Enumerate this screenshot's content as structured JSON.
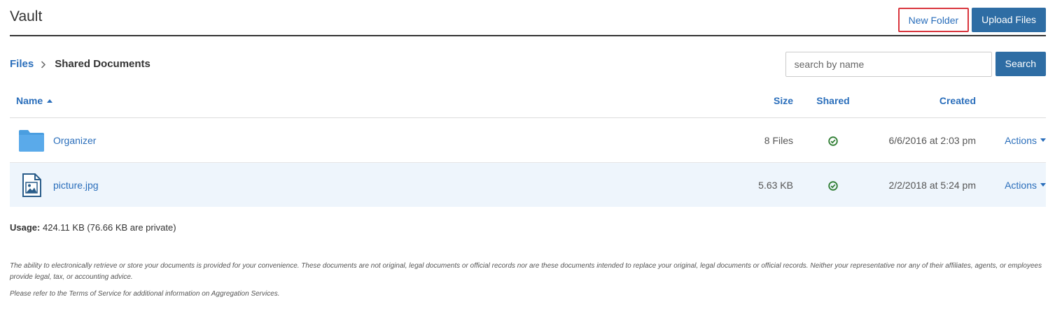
{
  "header": {
    "title": "Vault",
    "new_folder_label": "New Folder",
    "upload_files_label": "Upload Files"
  },
  "breadcrumb": {
    "root": "Files",
    "current": "Shared Documents"
  },
  "search": {
    "placeholder": "search by name",
    "value": "",
    "button_label": "Search"
  },
  "table": {
    "columns": {
      "name": "Name",
      "size": "Size",
      "shared": "Shared",
      "created": "Created"
    },
    "sort": {
      "column": "name",
      "direction": "ascending"
    },
    "rows": [
      {
        "icon": "folder-icon",
        "name": "Organizer",
        "size": "8 Files",
        "shared": true,
        "created": "6/6/2016 at 2:03 pm",
        "actions_label": "Actions"
      },
      {
        "icon": "image-file-icon",
        "name": "picture.jpg",
        "size": "5.63 KB",
        "shared": true,
        "created": "2/2/2018 at 5:24 pm",
        "actions_label": "Actions"
      }
    ]
  },
  "usage": {
    "label": "Usage:",
    "value": "424.11 KB (76.66 KB are private)"
  },
  "disclaimer": {
    "paragraph1": "The ability to electronically retrieve or store your documents is provided for your convenience. These documents are not original, legal documents or official records nor are these documents intended to replace your original, legal documents or official records. Neither your representative nor any of their affiliates, agents, or employees provide legal, tax, or accounting advice.",
    "paragraph2": "Please refer to the Terms of Service for additional information on Aggregation Services."
  },
  "colors": {
    "link": "#2a6ebb",
    "primary_button": "#2e6da4",
    "highlight_border": "#d9363e",
    "folder": "#4a9ee0",
    "shared_check": "#2e7d32",
    "alt_row": "#eef5fc"
  }
}
